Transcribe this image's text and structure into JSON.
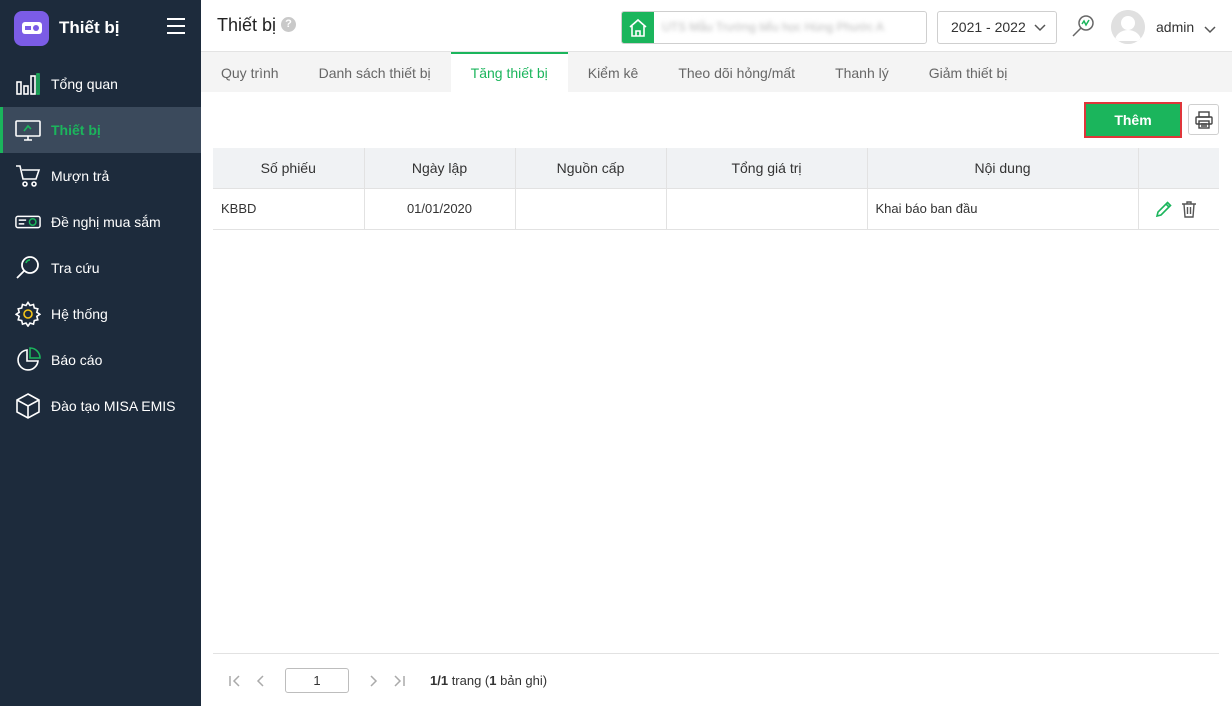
{
  "app": {
    "title": "Thiết bị",
    "brand_color": "#1bb55c",
    "sidebar_bg": "#1d2b3c"
  },
  "sidebar": {
    "items": [
      {
        "label": "Tổng quan",
        "icon": "bar-chart-icon"
      },
      {
        "label": "Thiết bị",
        "icon": "monitor-icon",
        "active": true
      },
      {
        "label": "Mượn trả",
        "icon": "cart-icon"
      },
      {
        "label": "Đề nghị mua sắm",
        "icon": "projector-icon"
      },
      {
        "label": "Tra cứu",
        "icon": "search-icon"
      },
      {
        "label": "Hệ thống",
        "icon": "gear-icon"
      },
      {
        "label": "Báo cáo",
        "icon": "pie-chart-icon"
      },
      {
        "label": "Đào tạo MISA EMIS",
        "icon": "box-icon"
      }
    ]
  },
  "header": {
    "title": "Thiết bị",
    "help": "?",
    "school_name": "UTS Mẫu Trường tiểu học Hùng Phước A",
    "year": "2021 - 2022",
    "user": "admin"
  },
  "tabs": [
    {
      "label": "Quy trình"
    },
    {
      "label": "Danh sách thiết bị"
    },
    {
      "label": "Tăng thiết bị",
      "active": true
    },
    {
      "label": "Kiểm kê"
    },
    {
      "label": "Theo dõi hỏng/mất"
    },
    {
      "label": "Thanh lý"
    },
    {
      "label": "Giảm thiết bị"
    }
  ],
  "toolbar": {
    "add_label": "Thêm"
  },
  "table": {
    "columns": [
      "Số phiếu",
      "Ngày lập",
      "Nguồn cấp",
      "Tổng giá trị",
      "Nội dung"
    ],
    "rows": [
      {
        "so_phieu": "KBBD",
        "ngay_lap": "01/01/2020",
        "nguon_cap": "",
        "tong_gia_tri": "",
        "noi_dung": "Khai báo ban đầu"
      }
    ]
  },
  "pagination": {
    "page": "1",
    "info_pages": "1/1",
    "info_trang": " trang (",
    "info_records": "1",
    "info_suffix": " bản ghi)"
  }
}
